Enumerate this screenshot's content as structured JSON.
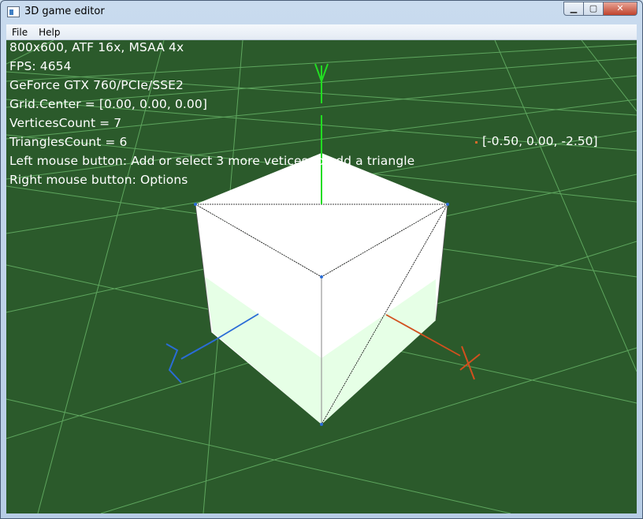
{
  "window": {
    "title": "3D game editor",
    "controls": {
      "minimize": "▁",
      "maximize": "▢",
      "close": "✕"
    }
  },
  "menu": {
    "items": [
      "File",
      "Help"
    ]
  },
  "overlay": {
    "lines": [
      "800x600, ATF 16x, MSAA 4x",
      "FPS: 4654",
      "GeForce GTX 760/PCIe/SSE2",
      "Grid.Center = [0.00, 0.00, 0.00]",
      "VerticesCount = 7",
      "TrianglesCount = 6",
      "Left mouse button: Add or select 3 more vetices to add a triangle",
      "Right mouse button: Options"
    ]
  },
  "vertex_label": "[-0.50, 0.00, -2.50]",
  "scene": {
    "background_color": "#2b5a2b",
    "grid_color": "#6fbf6f",
    "axis_colors": {
      "x": "#d2501e",
      "y": "#22dd22",
      "z": "#2a6cd6"
    },
    "axis_names": {
      "x": "x-axis",
      "y": "y-axis",
      "z": "z-axis"
    }
  }
}
